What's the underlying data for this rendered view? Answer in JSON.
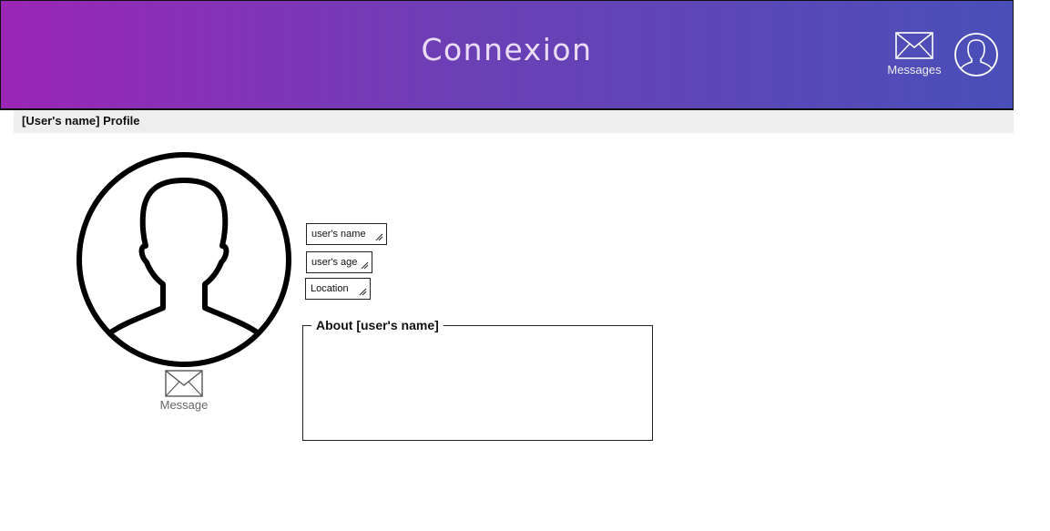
{
  "header": {
    "brand": "Connexion",
    "messages_label": "Messages",
    "accent_start": "#9a26b6",
    "accent_end": "#4a4fb8"
  },
  "profile": {
    "title": "[User's name] Profile",
    "message_label": "Message",
    "fields": {
      "name": "user's name",
      "age": "user's age",
      "location": "Location"
    },
    "about_legend": "About [user's name]"
  },
  "icons": {
    "mail": "envelope-icon",
    "user": "user-avatar-icon",
    "resize": "resize-grip-icon"
  }
}
